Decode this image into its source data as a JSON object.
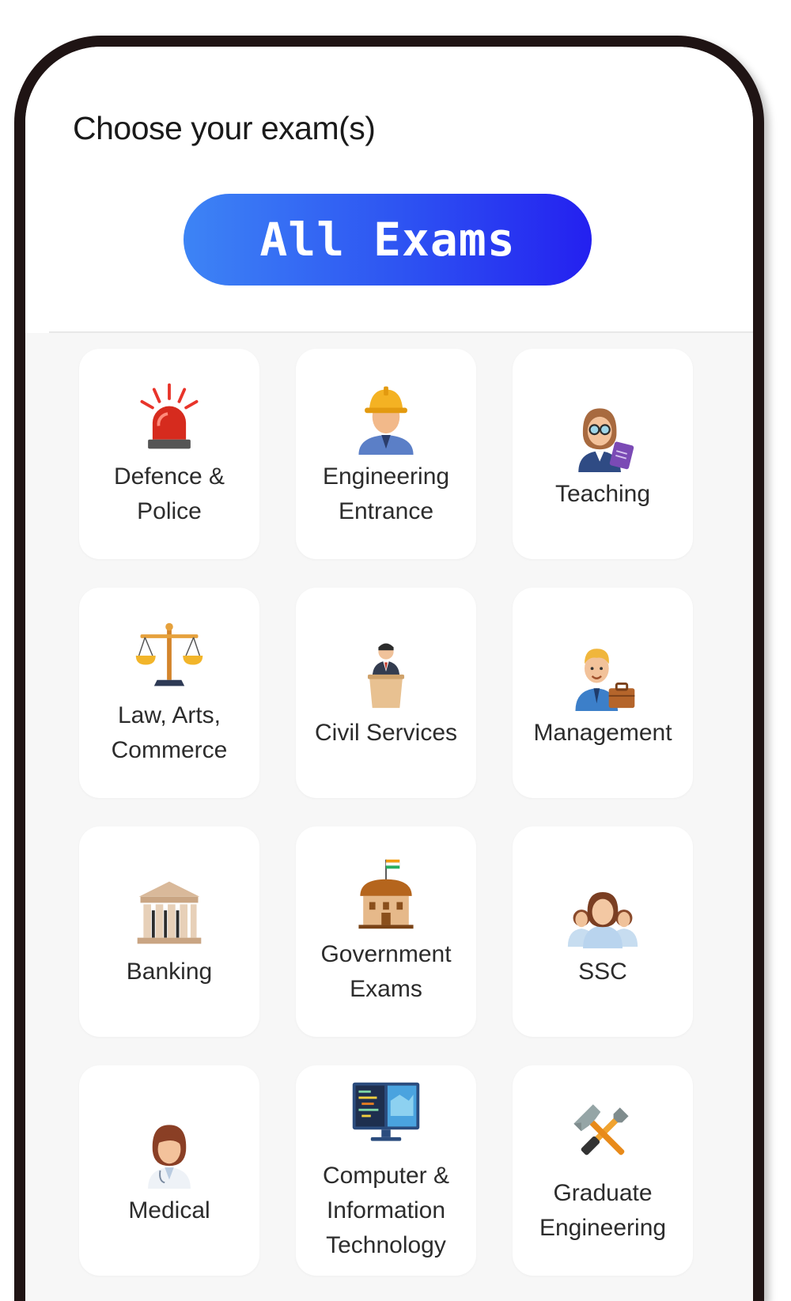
{
  "header": {
    "title": "Choose your exam(s)",
    "all_exams_label": "All Exams"
  },
  "colors": {
    "button_gradient_start": "#3d84f5",
    "button_gradient_end": "#2420f0",
    "frame": "#1f1414",
    "grid_background": "#f7f7f7"
  },
  "categories": [
    {
      "label": "Defence &\nPolice",
      "icon": "siren-icon"
    },
    {
      "label": "Engineering\nEntrance",
      "icon": "engineer-hardhat-icon"
    },
    {
      "label": "Teaching",
      "icon": "teacher-icon"
    },
    {
      "label": "Law, Arts,\nCommerce",
      "icon": "scales-of-justice-icon"
    },
    {
      "label": "Civil Services",
      "icon": "podium-speaker-icon"
    },
    {
      "label": "Management",
      "icon": "manager-briefcase-icon"
    },
    {
      "label": "Banking",
      "icon": "bank-building-icon"
    },
    {
      "label": "Government\nExams",
      "icon": "government-building-icon"
    },
    {
      "label": "SSC",
      "icon": "group-people-icon"
    },
    {
      "label": "Medical",
      "icon": "doctor-icon"
    },
    {
      "label": "Computer &\nInformation\nTechnology",
      "icon": "computer-monitor-icon"
    },
    {
      "label": "Graduate\nEngineering",
      "icon": "hammer-wrench-icon"
    }
  ]
}
